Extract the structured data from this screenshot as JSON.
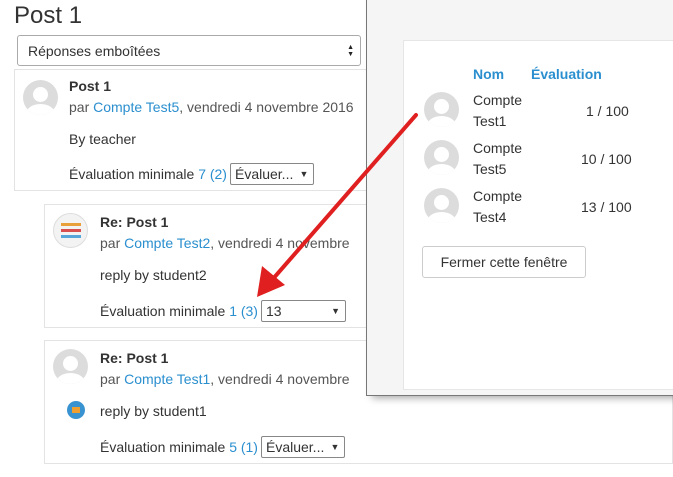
{
  "page": {
    "title": "Post 1"
  },
  "display_mode": {
    "selected": "Réponses emboîtées"
  },
  "posts": [
    {
      "title": "Post 1",
      "meta_prefix": "par ",
      "author": "Compte Test5",
      "date": ", vendredi 4 novembre 2016",
      "text": "By teacher",
      "rating_label": "Évaluation minimale ",
      "rating_value": "7 (2)",
      "rating_select": "Évaluer..."
    },
    {
      "title": "Re: Post 1",
      "meta_prefix": "par ",
      "author": "Compte Test2",
      "date": ", vendredi 4 novembre",
      "text": "reply by student2",
      "rating_label": "Évaluation minimale ",
      "rating_value": "1 (3)",
      "rating_select": "13"
    },
    {
      "title": "Re: Post 1",
      "meta_prefix": "par ",
      "author": "Compte Test1",
      "date": ", vendredi 4 novembre",
      "text": "reply by student1",
      "rating_label": "Évaluation minimale ",
      "rating_value": "5 (1)",
      "rating_select": "Évaluer..."
    }
  ],
  "popup": {
    "headers": {
      "name": "Nom",
      "rating": "Évaluation"
    },
    "rows": [
      {
        "name_line1": "Compte",
        "name_line2": "Test1",
        "rating": "1 / 100"
      },
      {
        "name_line1": "Compte",
        "name_line2": "Test5",
        "rating": "10 / 100"
      },
      {
        "name_line1": "Compte",
        "name_line2": "Test4",
        "rating": "13 / 100"
      }
    ],
    "close_label": "Fermer cette fenêtre"
  },
  "annotation": {
    "arrow_color": "#e02020"
  },
  "colors": {
    "link": "#2b8fcf",
    "text": "#333333"
  }
}
